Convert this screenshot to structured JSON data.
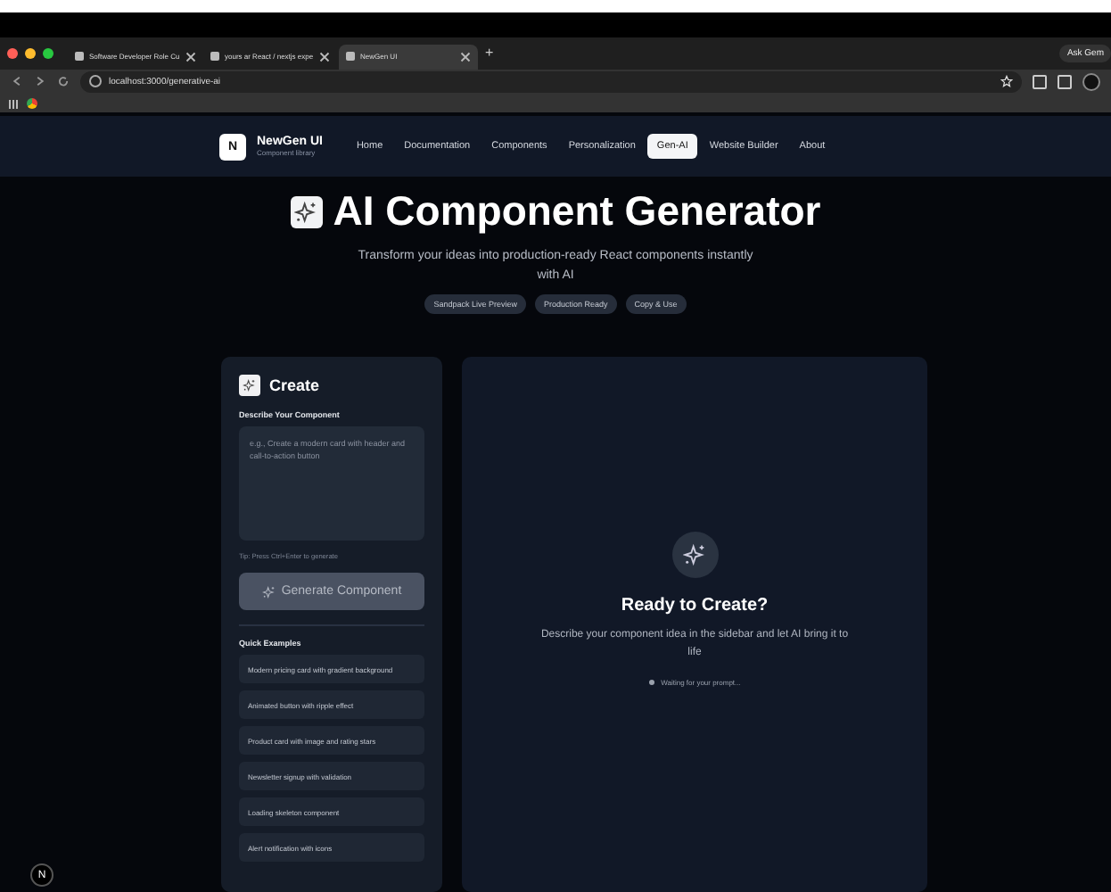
{
  "browser": {
    "tabs": [
      {
        "title": "Software Developer Role Cu",
        "selected": false
      },
      {
        "title": "yours ar React / nextjs expe",
        "selected": false
      },
      {
        "title": "NewGen UI",
        "selected": true
      }
    ],
    "new_tab": "+",
    "ask_button": "Ask Gem",
    "url": "localhost:3000/generative-ai"
  },
  "navbar": {
    "logo_letter": "N",
    "brand": "NewGen UI",
    "tagline": "Component library",
    "items": [
      {
        "label": "Home",
        "selected": false
      },
      {
        "label": "Documentation",
        "selected": false
      },
      {
        "label": "Components",
        "selected": false
      },
      {
        "label": "Personalization",
        "selected": false
      },
      {
        "label": "Gen-AI",
        "selected": true
      },
      {
        "label": "Website Builder",
        "selected": false
      },
      {
        "label": "About",
        "selected": false
      }
    ]
  },
  "hero": {
    "title": "AI Component Generator",
    "subtitle": "Transform your ideas into production-ready React components instantly with AI",
    "badges": [
      "Sandpack Live Preview",
      "Production Ready",
      "Copy & Use"
    ]
  },
  "create": {
    "title": "Create",
    "label": "Describe Your Component",
    "placeholder": "e.g., Create a modern card with header and call-to-action button",
    "tip": "Tip: Press Ctrl+Enter to generate",
    "button": "Generate Component",
    "button_disabled": true,
    "examples_title": "Quick Examples",
    "examples": [
      "Modern pricing card with gradient background",
      "Animated button with ripple effect",
      "Product card with image and rating stars",
      "Newsletter signup with validation",
      "Loading skeleton component",
      "Alert notification with icons"
    ]
  },
  "preview": {
    "title": "Ready to Create?",
    "text": "Describe your component idea in the sidebar and let AI bring it to life",
    "status": "Waiting for your prompt..."
  },
  "dev_badge": "N"
}
